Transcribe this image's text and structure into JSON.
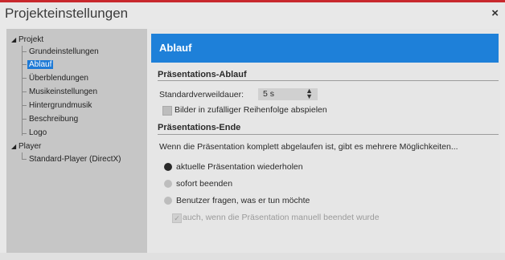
{
  "window": {
    "title": "Projekteinstellungen",
    "close_glyph": "×"
  },
  "tree": {
    "projekt": "Projekt",
    "grundeinstellungen": "Grundeinstellungen",
    "ablauf": "Ablauf",
    "ueberblendungen": "Überblendungen",
    "musikeinstellungen": "Musikeinstellungen",
    "hintergrundmusik": "Hintergrundmusik",
    "beschreibung": "Beschreibung",
    "logo": "Logo",
    "player": "Player",
    "standard_player": "Standard-Player (DirectX)"
  },
  "panel": {
    "header": "Ablauf",
    "section1": "Präsentations-Ablauf",
    "standard_label": "Standardverweildauer:",
    "standard_value": "5 s",
    "random_label": "Bilder in zufälliger Reihenfolge abspielen",
    "section2": "Präsentations-Ende",
    "info": "Wenn die Präsentation komplett abgelaufen ist, gibt es mehrere Möglichkeiten...",
    "opt1": "aktuelle Präsentation wiederholen",
    "opt2": "sofort beenden",
    "opt3": "Benutzer fragen, was er tun möchte",
    "opt4": "auch, wenn die Präsentation manuell beendet wurde"
  },
  "colors": {
    "accent": "#1e80d9",
    "selection": "#1e7ad6",
    "top_border": "#c8282d"
  },
  "icons": {
    "expand": "▲",
    "spin": "▲▼",
    "check": "✓"
  }
}
